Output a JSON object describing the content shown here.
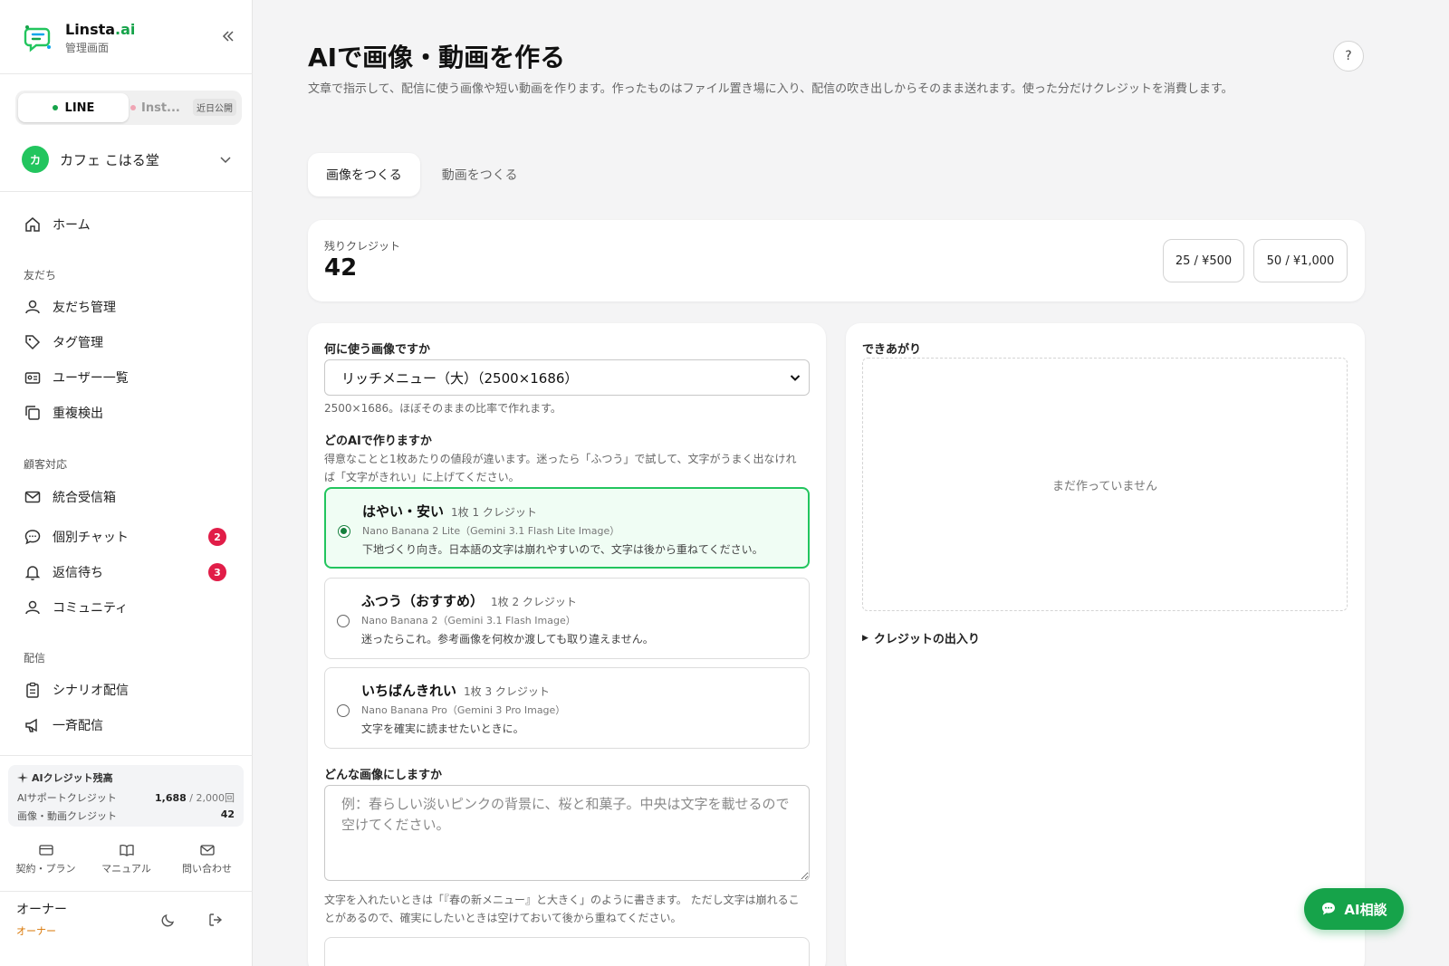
{
  "brand": {
    "name_main": "Linsta",
    "name_suffix": ".ai",
    "subtitle": "管理画面"
  },
  "channel": {
    "line_label": "LINE",
    "instagram_label": "Inst...",
    "instagram_badge": "近日公開"
  },
  "store": {
    "avatar": "カ",
    "name": "カフェ こはる堂"
  },
  "nav": {
    "home": "ホーム",
    "section_friends": "友だち",
    "friends_manage": "友だち管理",
    "tag_manage": "タグ管理",
    "user_list": "ユーザー一覧",
    "duplicate_check": "重複検出",
    "section_support": "顧客対応",
    "inbox": "統合受信箱",
    "chat": "個別チャット",
    "chat_badge": "2",
    "awaiting": "返信待ち",
    "awaiting_badge": "3",
    "community": "コミュニティ",
    "section_delivery": "配信",
    "scenario": "シナリオ配信",
    "broadcast": "一斉配信"
  },
  "sidebar_credits": {
    "title": "AIクレジット残高",
    "support_label": "AIサポートクレジット",
    "support_value": "1,688",
    "support_max": " / 2,000回",
    "image_label": "画像・動画クレジット",
    "image_value": "42"
  },
  "quick_links": {
    "plan": "契約・プラン",
    "manual": "マニュアル",
    "contact": "問い合わせ"
  },
  "owner": {
    "name": "オーナー",
    "role": "オーナー"
  },
  "page": {
    "title": "AIで画像・動画を作る",
    "description": "文章で指示して、配信に使う画像や短い動画を作ります。作ったものはファイル置き場に入り、配信の吹き出しからそのまま送れます。使った分だけクレジットを消費します。",
    "help": "?"
  },
  "tabs": {
    "image": "画像をつくる",
    "video": "動画をつくる"
  },
  "credits": {
    "label": "残りクレジット",
    "value": "42",
    "pack_small": "25 / ¥500",
    "pack_large": "50 / ¥1,000"
  },
  "form": {
    "usage_label": "何に使う画像ですか",
    "usage_value": "リッチメニュー（大）（2500×1686）",
    "usage_help": "2500×1686。ほぼそのままの比率で作れます。",
    "ai_label": "どのAIで作りますか",
    "ai_help": "得意なことと1枚あたりの値段が違います。迷ったら「ふつう」で試して、文字がうまく出なければ「文字がきれい」に上げてください。",
    "options": [
      {
        "title": "はやい・安い",
        "price": "1枚 1 クレジット",
        "model": "Nano Banana 2 Lite（Gemini 3.1 Flash Lite Image）",
        "desc": "下地づくり向き。日本語の文字は崩れやすいので、文字は後から重ねてください。"
      },
      {
        "title": "ふつう（おすすめ）",
        "price": "1枚 2 クレジット",
        "model": "Nano Banana 2（Gemini 3.1 Flash Image）",
        "desc": "迷ったらこれ。参考画像を何枚か渡しても取り違えません。"
      },
      {
        "title": "いちばんきれい",
        "price": "1枚 3 クレジット",
        "model": "Nano Banana Pro（Gemini 3 Pro Image）",
        "desc": "文字を確実に読ませたいときに。"
      }
    ],
    "prompt_label": "どんな画像にしますか",
    "prompt_placeholder": "例：春らしい淡いピンクの背景に、桜と和菓子。中央は文字を載せるので空けてください。",
    "prompt_help": "文字を入れたいときは「『春の新メニュー』と大きく」のように書きます。 ただし文字は崩れることがあるので、確実にしたいときは空けておいて後から重ねてください。"
  },
  "result": {
    "title": "できあがり",
    "empty": "まだ作っていません",
    "ledger": "クレジットの出入り"
  },
  "ai_chat": {
    "label": "AI相談"
  },
  "colors": {
    "accent": "#16a34a",
    "badge": "#e11d48",
    "selected_bg": "#f0fdf4"
  }
}
